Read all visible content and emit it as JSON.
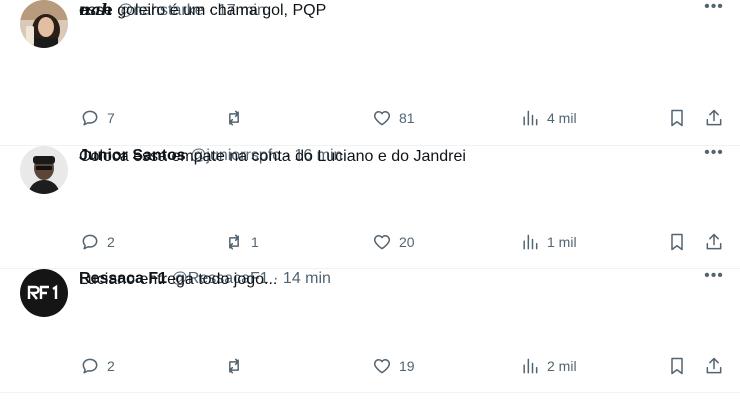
{
  "tweets": [
    {
      "name": "nah",
      "handle": "@nahstarke",
      "separator": "·",
      "time": "17 min",
      "text": "esse goleiro é um chama gol, PQP",
      "replies": "7",
      "retweets": "",
      "likes": "81",
      "views": "4 mil",
      "avatar_icon": "profile-photo"
    },
    {
      "name": "Junior Santos",
      "handle": "@juniorrspfc",
      "separator": "·",
      "time": "16 min",
      "text": "Coloca essa empate na conta do Luciano e do Jandrei",
      "replies": "2",
      "retweets": "1",
      "likes": "20",
      "views": "1 mil",
      "avatar_icon": "profile-photo"
    },
    {
      "name": "Ressaca F1",
      "handle": "@RessacaF1",
      "separator": "·",
      "time": "14 min",
      "text": "Luciano entrega todo jogo...",
      "replies": "2",
      "retweets": "",
      "likes": "19",
      "views": "2 mil",
      "avatar_icon": "rf1-logo"
    }
  ],
  "more_glyph": "•••",
  "colors": {
    "text": "#0f1419",
    "secondary": "#536471",
    "divider": "#eff3f4"
  }
}
